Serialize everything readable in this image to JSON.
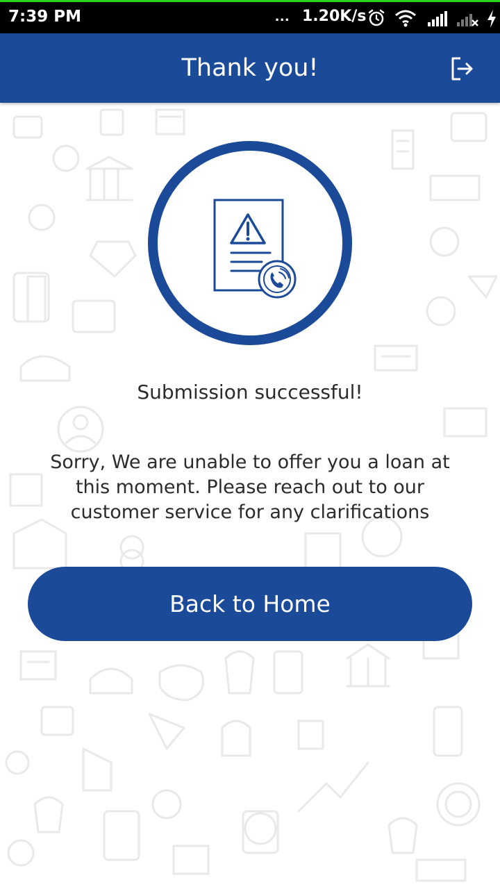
{
  "status_bar": {
    "time": "7:39 PM",
    "dots": "...",
    "network_speed": "1.20K/s",
    "icons": [
      "alarm-icon",
      "wifi-icon",
      "signal-icon",
      "signal-no-sim-icon",
      "charging-icon"
    ]
  },
  "header": {
    "title": "Thank you!",
    "logout_icon": "logout-icon"
  },
  "main": {
    "illustration_icon": "document-warning-phone-icon",
    "success_text": "Submission successful!",
    "message": "Sorry, We are unable to offer you a loan at this moment. Please reach out to our customer service for any clarifications",
    "button_label": "Back to Home"
  },
  "colors": {
    "primary": "#1a4a98",
    "status_bar": "#000000",
    "status_accent": "#2bd21f",
    "text": "#2b2b2b",
    "background": "#ffffff"
  }
}
